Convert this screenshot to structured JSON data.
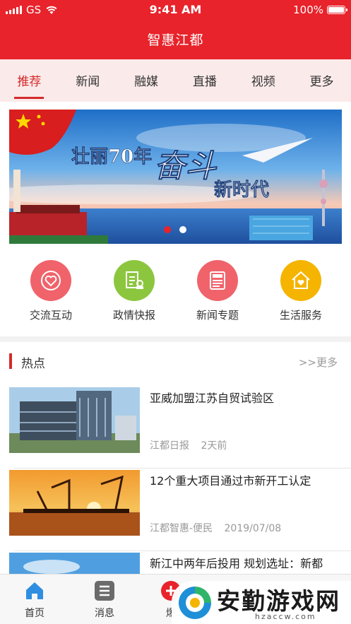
{
  "status": {
    "carrier": "GS",
    "time": "9:41 AM",
    "battery": "100%"
  },
  "app": {
    "title": "智惠江都"
  },
  "tabs": [
    {
      "label": "推荐"
    },
    {
      "label": "新闻"
    },
    {
      "label": "融媒"
    },
    {
      "label": "直播"
    },
    {
      "label": "视频"
    },
    {
      "label": "更多"
    }
  ],
  "banner": {
    "headline": "壮丽70年",
    "script_text": "奋斗",
    "subline": "新时代",
    "slide_count": 2,
    "active_slide": 0
  },
  "quick_menu": [
    {
      "label": "交流互动",
      "icon": "heart-chat-icon",
      "color": "#f0636b"
    },
    {
      "label": "政情快报",
      "icon": "government-report-icon",
      "color": "#8cc63f"
    },
    {
      "label": "新闻专题",
      "icon": "newspaper-icon",
      "color": "#f0636b"
    },
    {
      "label": "生活服务",
      "icon": "home-heart-icon",
      "color": "#f5b400"
    }
  ],
  "hot": {
    "title": "热点",
    "more": ">>更多"
  },
  "news": [
    {
      "title": "亚威加盟江苏自贸试验区",
      "source": "江都日报",
      "time": "2天前"
    },
    {
      "title": "12个重大项目通过市新开工认定",
      "source": "江都智惠-便民",
      "time": "2019/07/08"
    },
    {
      "title": "新江中两年后投用 规划选址：新都",
      "source": "",
      "time": ""
    }
  ],
  "tabbar": [
    {
      "label": "首页",
      "icon": "home-icon"
    },
    {
      "label": "消息",
      "icon": "list-icon"
    },
    {
      "label": "爆",
      "icon": "plus-icon"
    }
  ],
  "watermark": {
    "text": "安勤游戏网",
    "url": "hzaccw.com"
  },
  "colors": {
    "brand": "#e8232b",
    "tab_active": "#d42a2a",
    "tab_bg": "#fbeaea"
  }
}
